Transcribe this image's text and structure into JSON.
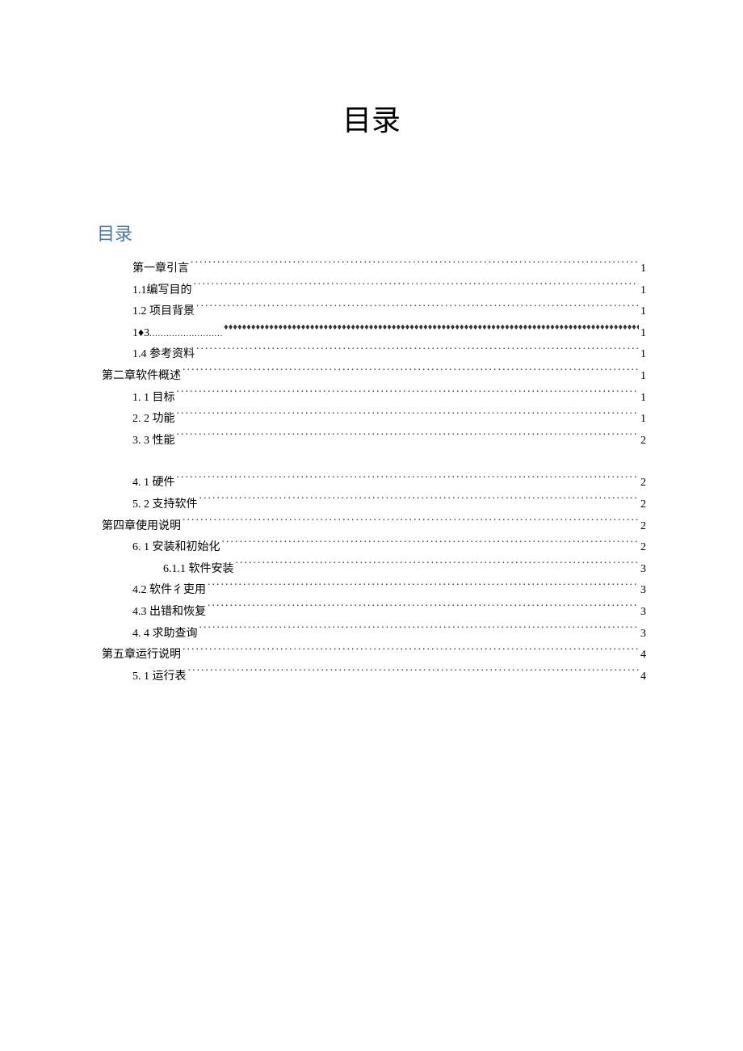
{
  "title": "目录",
  "section_heading": "目录",
  "entries": [
    {
      "label": "第一章引言",
      "page": "1",
      "indent": 1,
      "leader": "dots"
    },
    {
      "label": "1.1编写目的",
      "page": "1",
      "indent": 1,
      "leader": "dots"
    },
    {
      "label": "1.2 项目背景",
      "page": "1",
      "indent": 1,
      "leader": "dots"
    },
    {
      "label": "1♦3",
      "page": "1",
      "indent": 1,
      "leader": "diamond"
    },
    {
      "label": "1.4 参考资料",
      "page": "1",
      "indent": 1,
      "leader": "dots"
    },
    {
      "label": "第二章软件概述",
      "page": "1",
      "indent": 0,
      "leader": "dots"
    },
    {
      "label": "1.  1 目标",
      "page": "1",
      "indent": 1,
      "leader": "dots"
    },
    {
      "label": "2.  2 功能",
      "page": "1",
      "indent": 1,
      "leader": "dots"
    },
    {
      "label": "3.  3 性能",
      "page": "2",
      "indent": 1,
      "leader": "dots"
    },
    {
      "label": "",
      "page": "",
      "indent": 1,
      "leader": "blank"
    },
    {
      "label": "4.  1 硬件",
      "page": "2",
      "indent": 1,
      "leader": "dots"
    },
    {
      "label": "5.  2 支持软件",
      "page": "2",
      "indent": 1,
      "leader": "dots"
    },
    {
      "label": "第四章使用说明",
      "page": "2",
      "indent": 0,
      "leader": "dots"
    },
    {
      "label": "6.  1 安装和初始化",
      "page": "2",
      "indent": 1,
      "leader": "dots"
    },
    {
      "label": "6.1.1    软件安装",
      "page": "3",
      "indent": 2,
      "leader": "dots"
    },
    {
      "label": "4.2 软件彳吏用",
      "page": "3",
      "indent": 1,
      "leader": "dots"
    },
    {
      "label": "4.3 出错和恢复",
      "page": "3",
      "indent": 1,
      "leader": "dots"
    },
    {
      "label": "4.  4 求助查询",
      "page": "3",
      "indent": 1,
      "leader": "dots"
    },
    {
      "label": "第五章运行说明",
      "page": "4",
      "indent": 0,
      "leader": "dots"
    },
    {
      "label": "5.  1 运行表",
      "page": "4",
      "indent": 1,
      "leader": "dots"
    }
  ]
}
